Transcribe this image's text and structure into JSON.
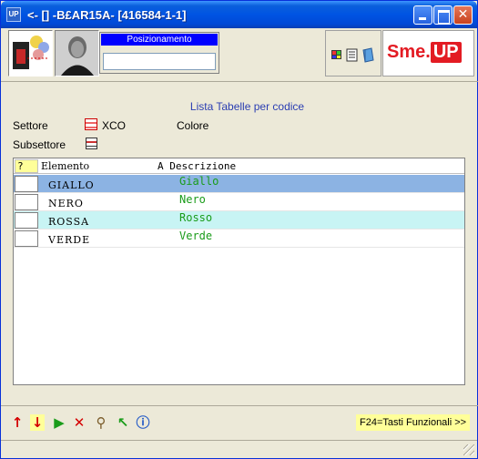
{
  "window": {
    "title": "<- [] -B£AR15A- [416584-1-1]",
    "app_icon_text": "UP"
  },
  "toolbar": {
    "position_title": "Posizionamento",
    "position_value": "",
    "logo_text_left": "Sme.",
    "logo_text_right": "UP"
  },
  "content": {
    "list_title": "Lista Tabelle per codice",
    "settore_label": "Settore",
    "settore_value": "XCO",
    "colore_label": "Colore",
    "subsettore_label": "Subsettore"
  },
  "grid": {
    "header_q": "?",
    "header_element": "Elemento",
    "header_description": "A Descrizione",
    "rows": [
      {
        "element": "GIALLO",
        "description": "Giallo"
      },
      {
        "element": "NERO",
        "description": "Nero"
      },
      {
        "element": "ROSSA",
        "description": "Rosso"
      },
      {
        "element": "VERDE",
        "description": "Verde"
      }
    ]
  },
  "bottom": {
    "fkeys_label": "F24=Tasti Funzionali >>"
  },
  "colors": {
    "selected_row": "#8cb3e3",
    "alt_row": "#c8f4f4",
    "description_text": "#1a9c1a",
    "title_blue": "#2b3eb2"
  }
}
